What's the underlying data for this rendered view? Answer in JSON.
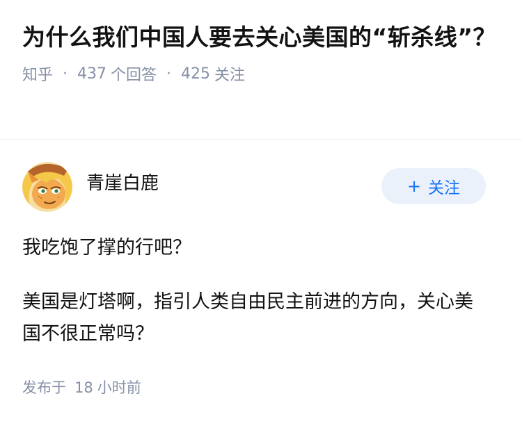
{
  "question": {
    "title": "为什么我们中国人要去关心美国的“斩杀线”？",
    "source": "知乎",
    "separator": "·",
    "answers_count": "437",
    "answers_label": "个回答",
    "followers_count": "425",
    "followers_label": "关注"
  },
  "answer": {
    "author_name": "青崖白鹿",
    "follow_plus": "+",
    "follow_label": "关注",
    "paragraphs": [
      "我吃饱了撑的行吧？",
      "美国是灯塔啊，指引人类自由民主前进的方向，关心美国不很正常吗？"
    ],
    "published_prefix": "发布于",
    "published_num": "18",
    "published_unit": "小时前"
  },
  "colors": {
    "accent": "#1772f6",
    "follow_bg": "#eaf1fb",
    "meta": "#8590a6",
    "text": "#121212"
  },
  "icons": {
    "avatar": "pony-avatar"
  }
}
